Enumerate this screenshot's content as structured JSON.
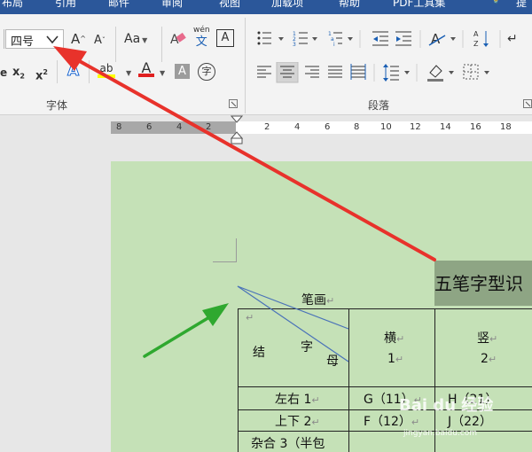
{
  "tabs": [
    "布局",
    "引用",
    "邮件",
    "审阅",
    "视图",
    "加载项",
    "帮助",
    "PDF工具集",
    "提"
  ],
  "font_group": {
    "font_size_value": "四号",
    "grow_font": "A",
    "shrink_font": "A",
    "change_case": "Aa",
    "clear_format": "A",
    "phonetic_top": "wén",
    "phonetic_bottom": "文",
    "char_border": "A",
    "subscript": "x",
    "subscript_mark": "2",
    "superscript": "x",
    "superscript_mark": "2",
    "text_effects": "A",
    "highlight": "ab",
    "font_color": "A",
    "char_shading": "A",
    "enclose_char": "字",
    "label": "字体"
  },
  "paragraph_group": {
    "label": "段落"
  },
  "ruler": {
    "left_numbers": [
      "8",
      "6",
      "4",
      "2"
    ],
    "right_numbers": [
      "2",
      "4",
      "6",
      "8",
      "10",
      "12",
      "14",
      "16",
      "18"
    ]
  },
  "document": {
    "title": "五笔字型识",
    "header_diag_top": "笔画",
    "header_diag_mid": "字",
    "header_diag_bottom": "母",
    "header_left": "结",
    "col_heng": "横",
    "col_heng_num": "1",
    "col_shu": "竖",
    "col_shu_num": "2",
    "rows": [
      {
        "label": "左右 1",
        "c1": "G（11）",
        "c2": "H（21）"
      },
      {
        "label": "上下 2",
        "c1": "F（12）",
        "c2": "J（22）"
      },
      {
        "label": "杂合 3（半包",
        "c1": "",
        "c2": ""
      }
    ],
    "para_mark": "↵"
  },
  "watermark": {
    "text": "Bai du 经验",
    "url": "jingyan.baidu.com"
  },
  "colors": {
    "title_bar": "#2b579a",
    "page_bg": "#c5e1b7",
    "title_cell": "#8ea584",
    "red_arrow": "#e8322b",
    "green_arrow": "#2fa82f"
  }
}
